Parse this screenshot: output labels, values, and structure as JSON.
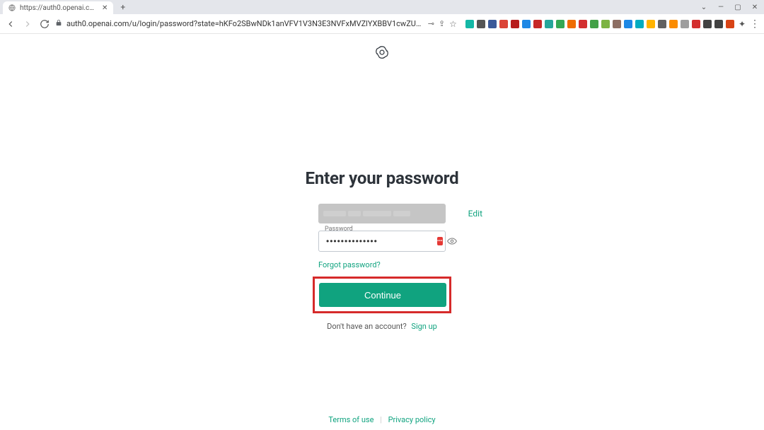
{
  "browser": {
    "tab_title": "https://auth0.openai.com/u/log…",
    "url": "auth0.openai.com/u/login/password?state=hKFo2SBwNDk1anVFV1V3N3E3NVFxMVZlYXBBV1cwZURObjNOZaFur3VuaXZlcnNhbC1sb2dpbqN0aWQgN0a…",
    "extension_colors": [
      "#14b8a6",
      "#555555",
      "#3b5998",
      "#db4437",
      "#b71c1c",
      "#1e88e5",
      "#c62828",
      "#26a69a",
      "#34a853",
      "#ef6c00",
      "#d32f2f",
      "#43a047",
      "#7cb342",
      "#8d6e63",
      "#1e88e5",
      "#00acc1",
      "#ffb300",
      "#616161",
      "#fb8c00",
      "#9e9e9e",
      "#d32f2f",
      "#424242",
      "#424242",
      "#d84315"
    ]
  },
  "page": {
    "heading": "Enter your password",
    "email_edit_label": "Edit",
    "password_label": "Password",
    "password_value": "••••••••••••••",
    "forgot_label": "Forgot password?",
    "continue_label": "Continue",
    "signup_prompt": "Don't have an account?",
    "signup_link": "Sign up"
  },
  "footer": {
    "terms": "Terms of use",
    "privacy": "Privacy policy"
  }
}
